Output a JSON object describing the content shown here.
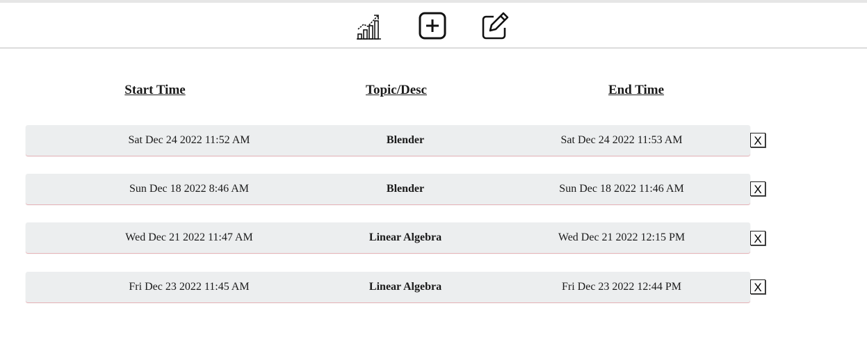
{
  "toolbar": {
    "icons": [
      "chart-icon",
      "plus-square-icon",
      "edit-icon"
    ]
  },
  "headers": {
    "start": "Start Time",
    "topic": "Topic/Desc",
    "end": "End Time"
  },
  "rows": [
    {
      "start": "Sat Dec 24 2022 11:52 AM",
      "topic": "Blender",
      "end": "Sat Dec 24 2022 11:53 AM",
      "delete": "X"
    },
    {
      "start": "Sun Dec 18 2022 8:46 AM",
      "topic": "Blender",
      "end": "Sun Dec 18 2022 11:46 AM",
      "delete": "X"
    },
    {
      "start": "Wed Dec 21 2022 11:47 AM",
      "topic": "Linear Algebra",
      "end": "Wed Dec 21 2022 12:15 PM",
      "delete": "X"
    },
    {
      "start": "Fri Dec 23 2022 11:45 AM",
      "topic": "Linear Algebra",
      "end": "Fri Dec 23 2022 12:44 PM",
      "delete": "X"
    }
  ],
  "colors": {
    "row_bg": "#eceeef",
    "row_accent": "#e6b3b8"
  }
}
